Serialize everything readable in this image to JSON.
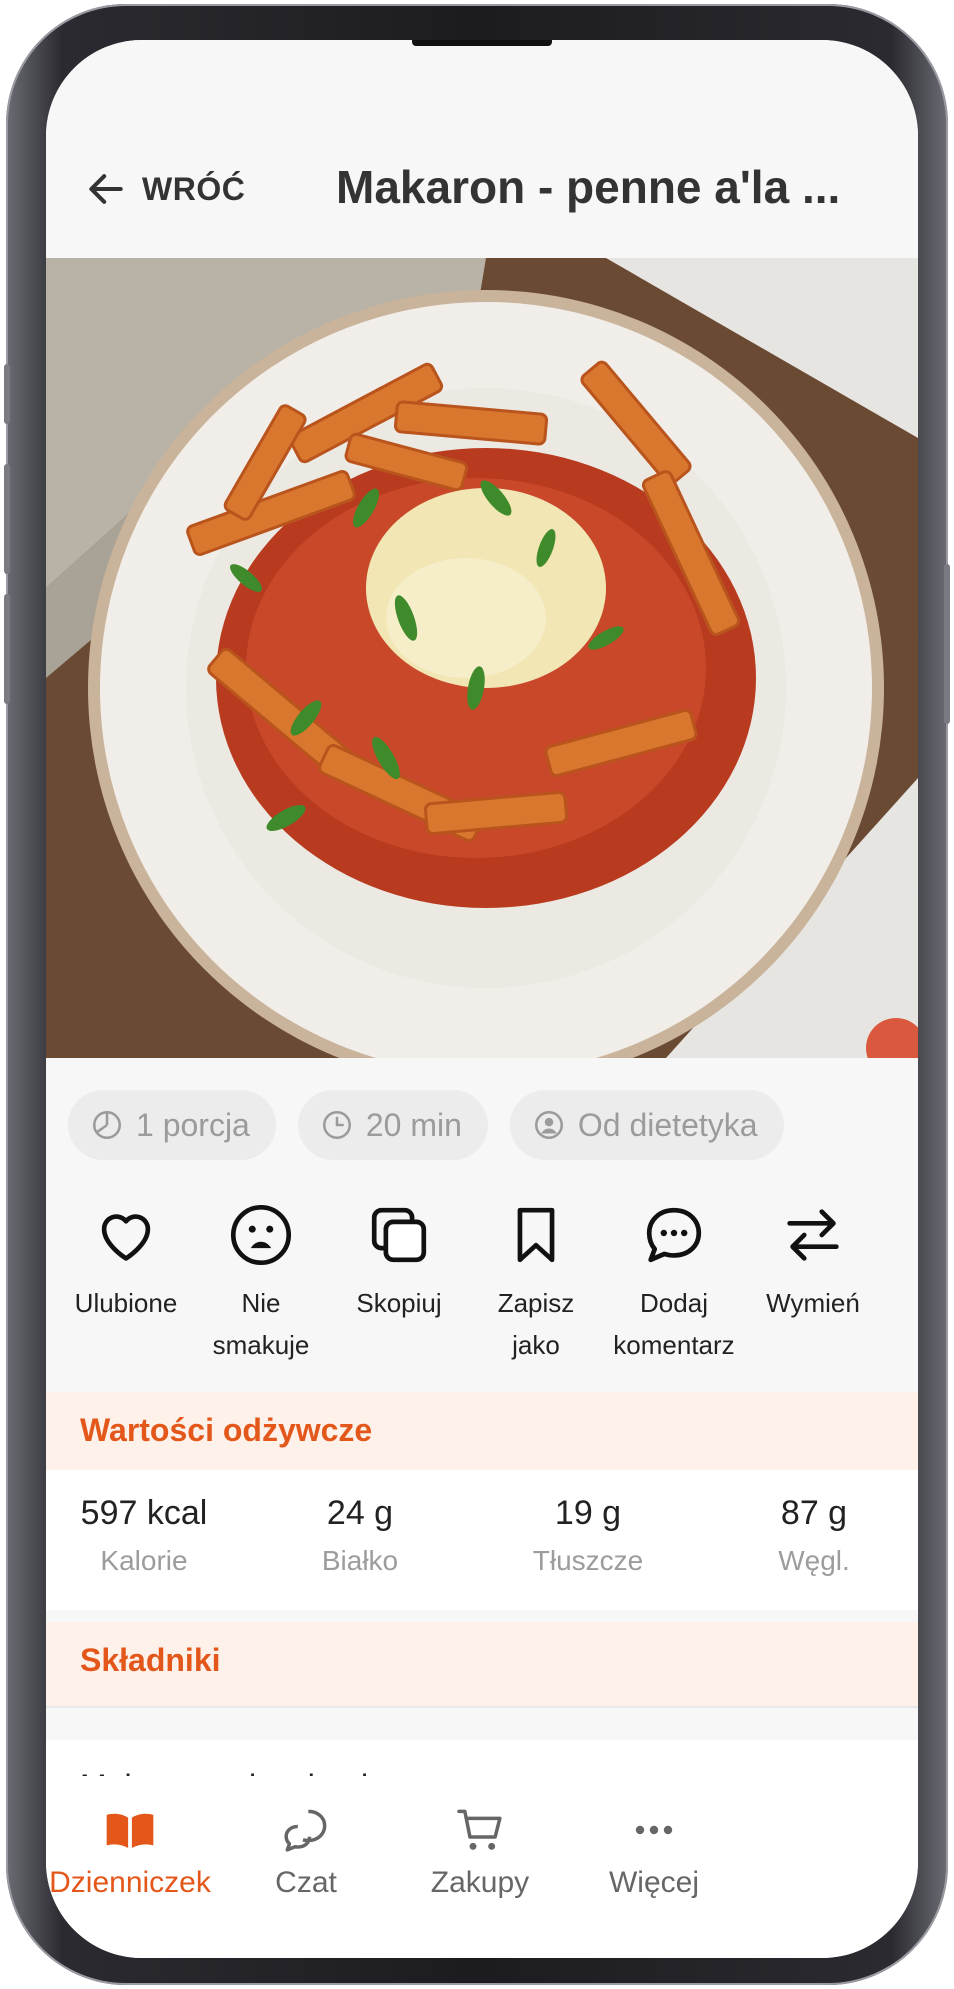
{
  "header": {
    "back_label": "WRÓĆ",
    "title": "Makaron - penne a'la ..."
  },
  "chips": [
    {
      "icon": "portion-icon",
      "label": "1 porcja"
    },
    {
      "icon": "clock-icon",
      "label": "20 min"
    },
    {
      "icon": "dietitian-icon",
      "label": "Od dietetyka"
    }
  ],
  "actions": [
    {
      "icon": "heart-icon",
      "line1": "Ulubione",
      "line2": ""
    },
    {
      "icon": "sad-face-icon",
      "line1": "Nie",
      "line2": "smakuje"
    },
    {
      "icon": "copy-icon",
      "line1": "Skopiuj",
      "line2": ""
    },
    {
      "icon": "bookmark-icon",
      "line1": "Zapisz",
      "line2": "jako"
    },
    {
      "icon": "comment-icon",
      "line1": "Dodaj",
      "line2": "komentarz"
    },
    {
      "icon": "swap-icon",
      "line1": "Wymień",
      "line2": ""
    }
  ],
  "nutrition": {
    "heading": "Wartości odżywcze",
    "items": [
      {
        "value": "597 kcal",
        "label": "Kalorie"
      },
      {
        "value": "24 g",
        "label": "Białko"
      },
      {
        "value": "19 g",
        "label": "Tłuszcze"
      },
      {
        "value": "87 g",
        "label": "Węgl."
      }
    ]
  },
  "ingredients": {
    "heading": "Składniki",
    "items": [
      "Makaron pełnoziarnisty"
    ]
  },
  "nav": [
    {
      "icon": "book-icon",
      "label": "Dzienniczek",
      "active": true
    },
    {
      "icon": "chat-icon",
      "label": "Czat",
      "active": false
    },
    {
      "icon": "cart-icon",
      "label": "Zakupy",
      "active": false
    },
    {
      "icon": "more-icon",
      "label": "Więcej",
      "active": false
    }
  ],
  "colors": {
    "accent": "#e4571a",
    "section_bg": "#fdf1ea",
    "chip_bg": "#ececec"
  }
}
